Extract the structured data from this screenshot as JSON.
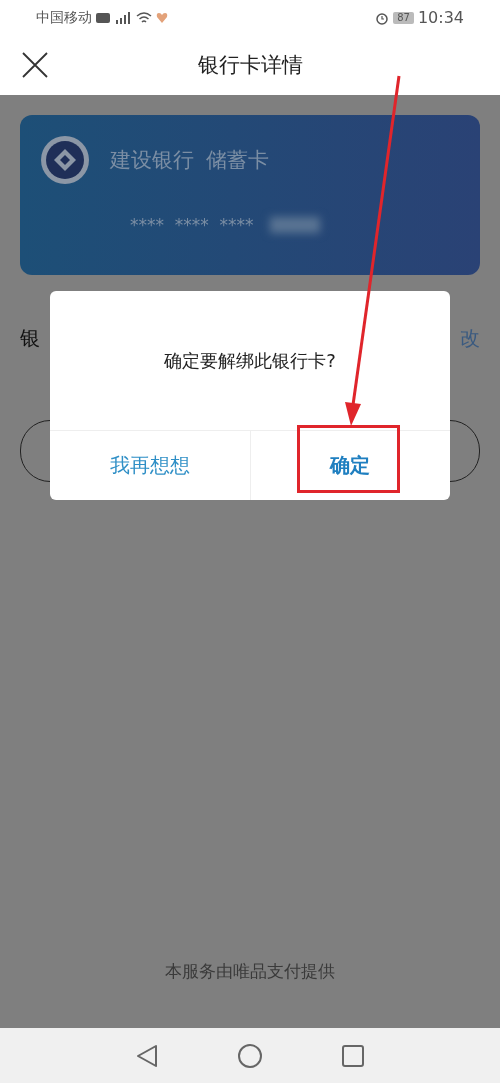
{
  "status_bar": {
    "carrier": "中国移动",
    "battery": "87",
    "time": "10:34"
  },
  "header": {
    "title": "银行卡详情"
  },
  "card": {
    "bank": "建设银行",
    "type": "储蓄卡",
    "number": "****  ****  ****"
  },
  "detail_row": {
    "label": "银",
    "action": "改"
  },
  "dialog": {
    "message": "确定要解绑此银行卡?",
    "buttons": [
      {
        "label": "我再想想",
        "kind": "cancel",
        "annotated": false
      },
      {
        "label": "确定",
        "kind": "confirm",
        "annotated": true
      }
    ]
  },
  "footer": "本服务由唯品支付提供"
}
